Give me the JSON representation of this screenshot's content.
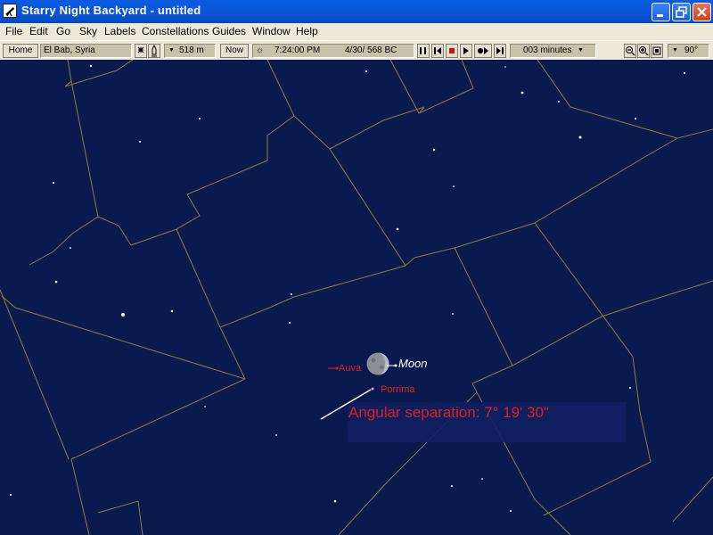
{
  "window": {
    "title": "Starry Night Backyard - untitled"
  },
  "menu": [
    "File",
    "Edit",
    "Go",
    "Sky",
    "Labels",
    "Constellations",
    "Guides",
    "Window",
    "Help"
  ],
  "toolbar": {
    "home_label": "Home",
    "location": "El Bab, Syria",
    "elevation": "518 m",
    "now_label": "Now",
    "time": "7:24:00 PM",
    "date": "4/30/ 568 BC",
    "time_step": "003 minutes",
    "field_of_view": "90°"
  },
  "sky": {
    "labels": {
      "moon": "Moon",
      "auva": "Auva",
      "porrima": "Porrima"
    },
    "measurement": "Angular separation: 7° 19' 30\"",
    "colors": {
      "sky": "#0b1a4e",
      "constellation_boundary": "#8a7d3a",
      "star_label": "#e02020",
      "moon_label": "#ffffff"
    }
  }
}
